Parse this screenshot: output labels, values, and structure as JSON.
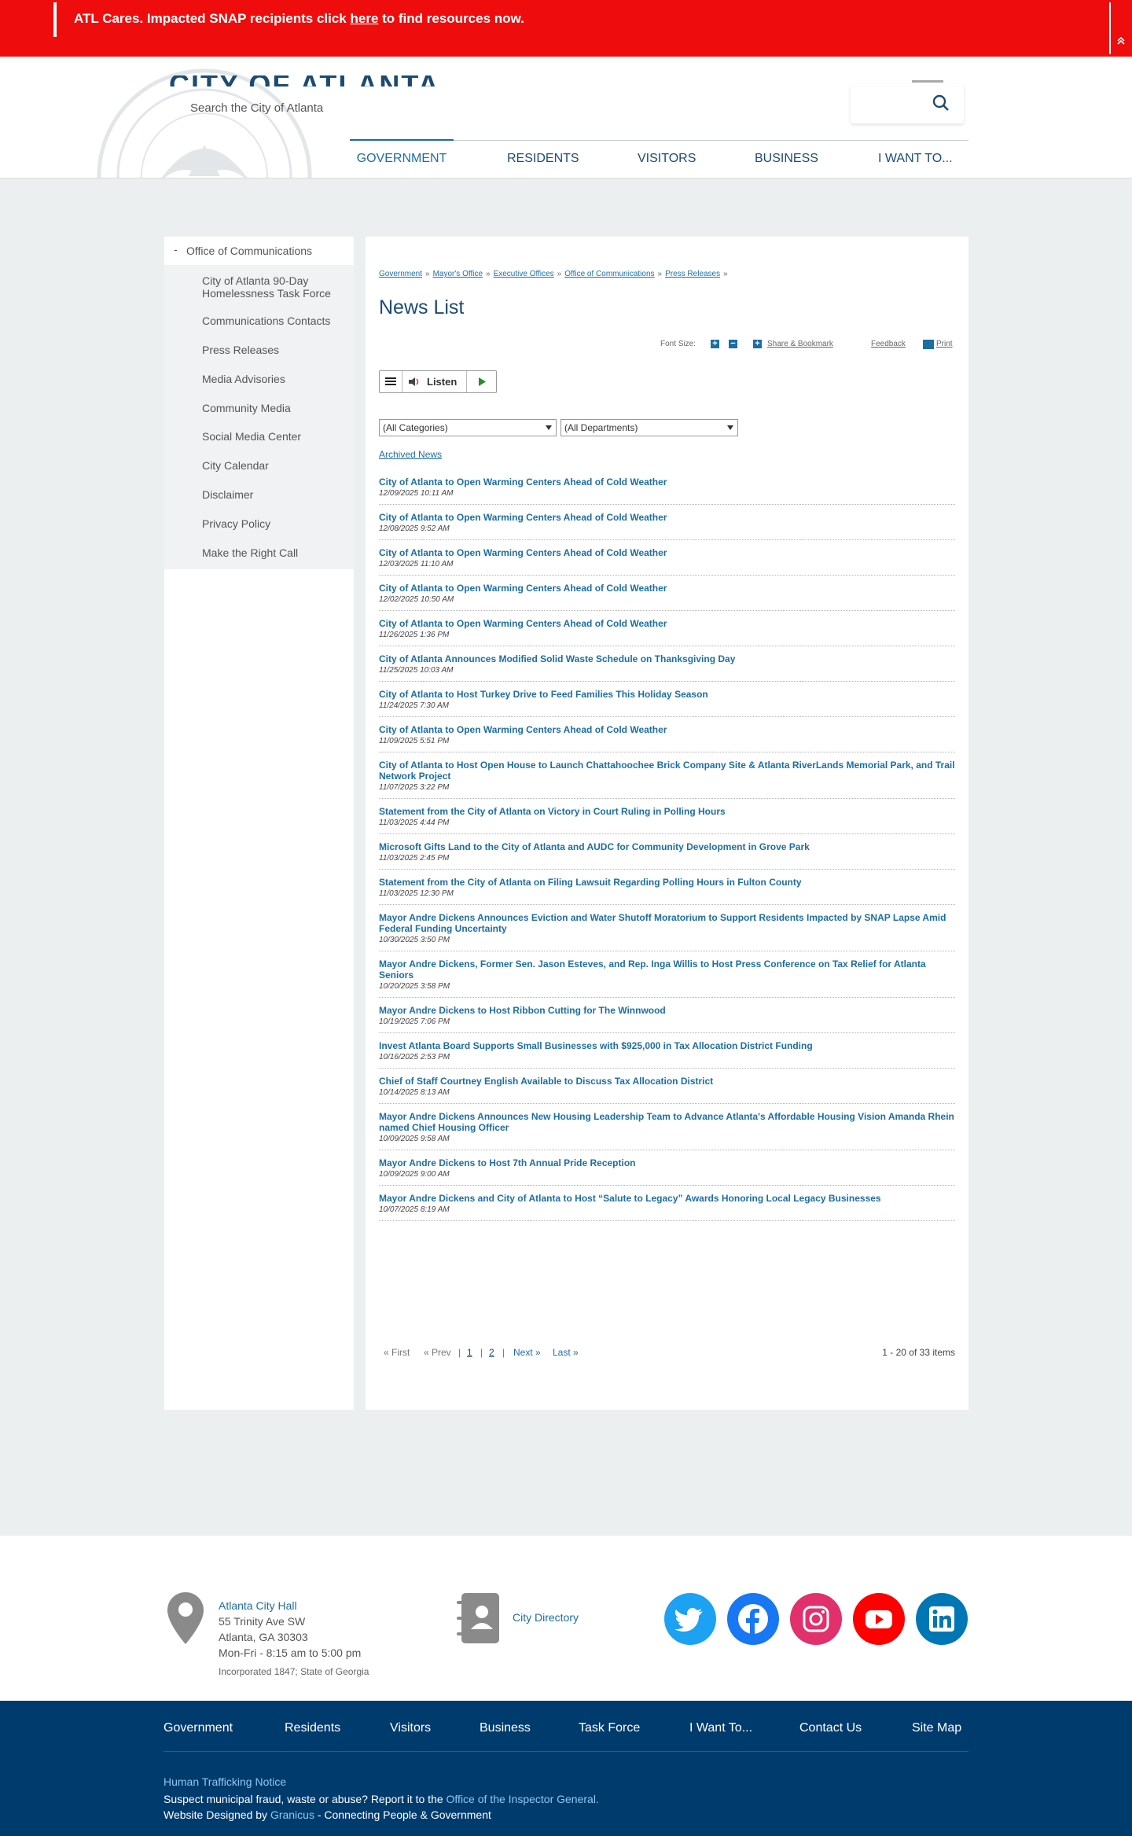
{
  "alert": {
    "before": "ATL Cares. Impacted SNAP recipients click ",
    "link": "here",
    "after": " to find resources now."
  },
  "header": {
    "city_name": "CITY OF ATLANTA, GA",
    "search_placeholder": "Search the City of Atlanta",
    "nav": [
      "GOVERNMENT",
      "RESIDENTS",
      "VISITORS",
      "BUSINESS",
      "I WANT TO..."
    ]
  },
  "sidebar": {
    "toggle": "-",
    "title": "Office of Communications",
    "items": [
      "City of Atlanta 90-Day Homelessness Task Force",
      "Communications Contacts",
      "Press Releases",
      "Media Advisories",
      "Community Media",
      "Social Media Center",
      "City Calendar",
      "Disclaimer",
      "Privacy Policy",
      "Make the Right Call"
    ]
  },
  "main": {
    "breadcrumb": [
      "Government",
      "Mayor's Office",
      "Executive Offices",
      "Office of Communications",
      "Press Releases"
    ],
    "breadcrumb_sep": "»",
    "title": "News List",
    "tools": {
      "font_size": "Font Size:",
      "share": "Share & Bookmark",
      "feedback": "Feedback",
      "print": "Print"
    },
    "listen": "Listen",
    "filters": {
      "categories": "(All Categories)",
      "departments": "(All Departments)"
    },
    "archived": "Archived News",
    "news": [
      {
        "title": "City of Atlanta to Open Warming Centers Ahead of Cold Weather",
        "date": "12/09/2025 10:11 AM"
      },
      {
        "title": "City of Atlanta to Open Warming Centers Ahead of Cold Weather",
        "date": "12/08/2025 9:52 AM"
      },
      {
        "title": "City of Atlanta to Open Warming Centers Ahead of Cold Weather",
        "date": "12/03/2025 11:10 AM"
      },
      {
        "title": "City of Atlanta to Open Warming Centers Ahead of Cold Weather",
        "date": "12/02/2025 10:50 AM"
      },
      {
        "title": "City of Atlanta to Open Warming Centers Ahead of Cold Weather",
        "date": "11/26/2025 1:36 PM"
      },
      {
        "title": "City of Atlanta Announces Modified Solid Waste Schedule on Thanksgiving Day",
        "date": "11/25/2025 10:03 AM"
      },
      {
        "title": "City of Atlanta to Host Turkey Drive to Feed Families This Holiday Season",
        "date": "11/24/2025 7:30 AM"
      },
      {
        "title": "City of Atlanta to Open Warming Centers Ahead of Cold Weather",
        "date": "11/09/2025 5:51 PM"
      },
      {
        "title": "City of Atlanta to Host Open House to Launch Chattahoochee Brick Company Site & Atlanta RiverLands Memorial Park, and Trail Network Project",
        "date": "11/07/2025 3:22 PM"
      },
      {
        "title": "Statement from the City of Atlanta on Victory in Court Ruling in Polling Hours",
        "date": "11/03/2025 4:44 PM"
      },
      {
        "title": "Microsoft Gifts Land to the City of Atlanta and AUDC for Community Development in Grove Park",
        "date": "11/03/2025 2:45 PM"
      },
      {
        "title": "Statement from the City of Atlanta on Filing Lawsuit Regarding Polling Hours in Fulton County",
        "date": "11/03/2025 12:30 PM"
      },
      {
        "title": "Mayor Andre Dickens Announces Eviction and Water Shutoff Moratorium to Support Residents Impacted by SNAP Lapse Amid Federal Funding Uncertainty",
        "date": "10/30/2025 3:50 PM"
      },
      {
        "title": "Mayor Andre Dickens, Former Sen. Jason Esteves, and Rep. Inga Willis to Host Press Conference on Tax Relief for Atlanta Seniors",
        "date": "10/20/2025 3:58 PM"
      },
      {
        "title": "Mayor Andre Dickens to Host Ribbon Cutting for The Winnwood",
        "date": "10/19/2025 7:06 PM"
      },
      {
        "title": "Invest Atlanta Board Supports Small Businesses with $925,000 in Tax Allocation District Funding",
        "date": "10/16/2025 2:53 PM"
      },
      {
        "title": "Chief of Staff Courtney English Available to Discuss Tax Allocation District",
        "date": "10/14/2025 8:13 AM"
      },
      {
        "title": "Mayor Andre Dickens Announces New Housing Leadership Team to Advance Atlanta's Affordable Housing Vision Amanda Rhein named Chief Housing Officer",
        "date": "10/09/2025 9:58 AM"
      },
      {
        "title": "Mayor Andre Dickens to Host 7th Annual Pride Reception",
        "date": "10/09/2025 9:00 AM"
      },
      {
        "title": "Mayor Andre Dickens and City of Atlanta to Host “Salute to Legacy” Awards Honoring Local Legacy Businesses",
        "date": "10/07/2025 8:19 AM"
      }
    ],
    "pager": {
      "first": "« First",
      "prev": "« Prev",
      "sep": "|",
      "page1": "1",
      "page2": "2",
      "next": "Next »",
      "last": "Last »",
      "count": "1 - 20 of 33 items"
    }
  },
  "footer": {
    "hall_title": "Atlanta City Hall",
    "street": "55 Trinity Ave SW",
    "city": "Atlanta, GA 30303",
    "hours": "Mon-Fri - 8:15 am to 5:00 pm",
    "incorporated": "Incorporated 1847; State of Georgia",
    "directory": "City Directory",
    "social_colors": {
      "twitter": "#1da1f2",
      "facebook": "#1877f2",
      "instagram": "#e1306c",
      "youtube": "#ff0000",
      "linkedin": "#0077b5"
    },
    "nav": [
      "Government",
      "Residents",
      "Visitors",
      "Business",
      "Task Force",
      "I Want To...",
      "Contact Us",
      "Site Map"
    ],
    "trafficking": "Human Trafficking Notice",
    "fraud_text": "Suspect municipal fraud, waste or abuse? Report it to the ",
    "fraud_link": "Office of the Inspector General.",
    "designed_by": "Website Designed by ",
    "granicus": "Granicus",
    "designed_tail": " - Connecting People & Government"
  }
}
